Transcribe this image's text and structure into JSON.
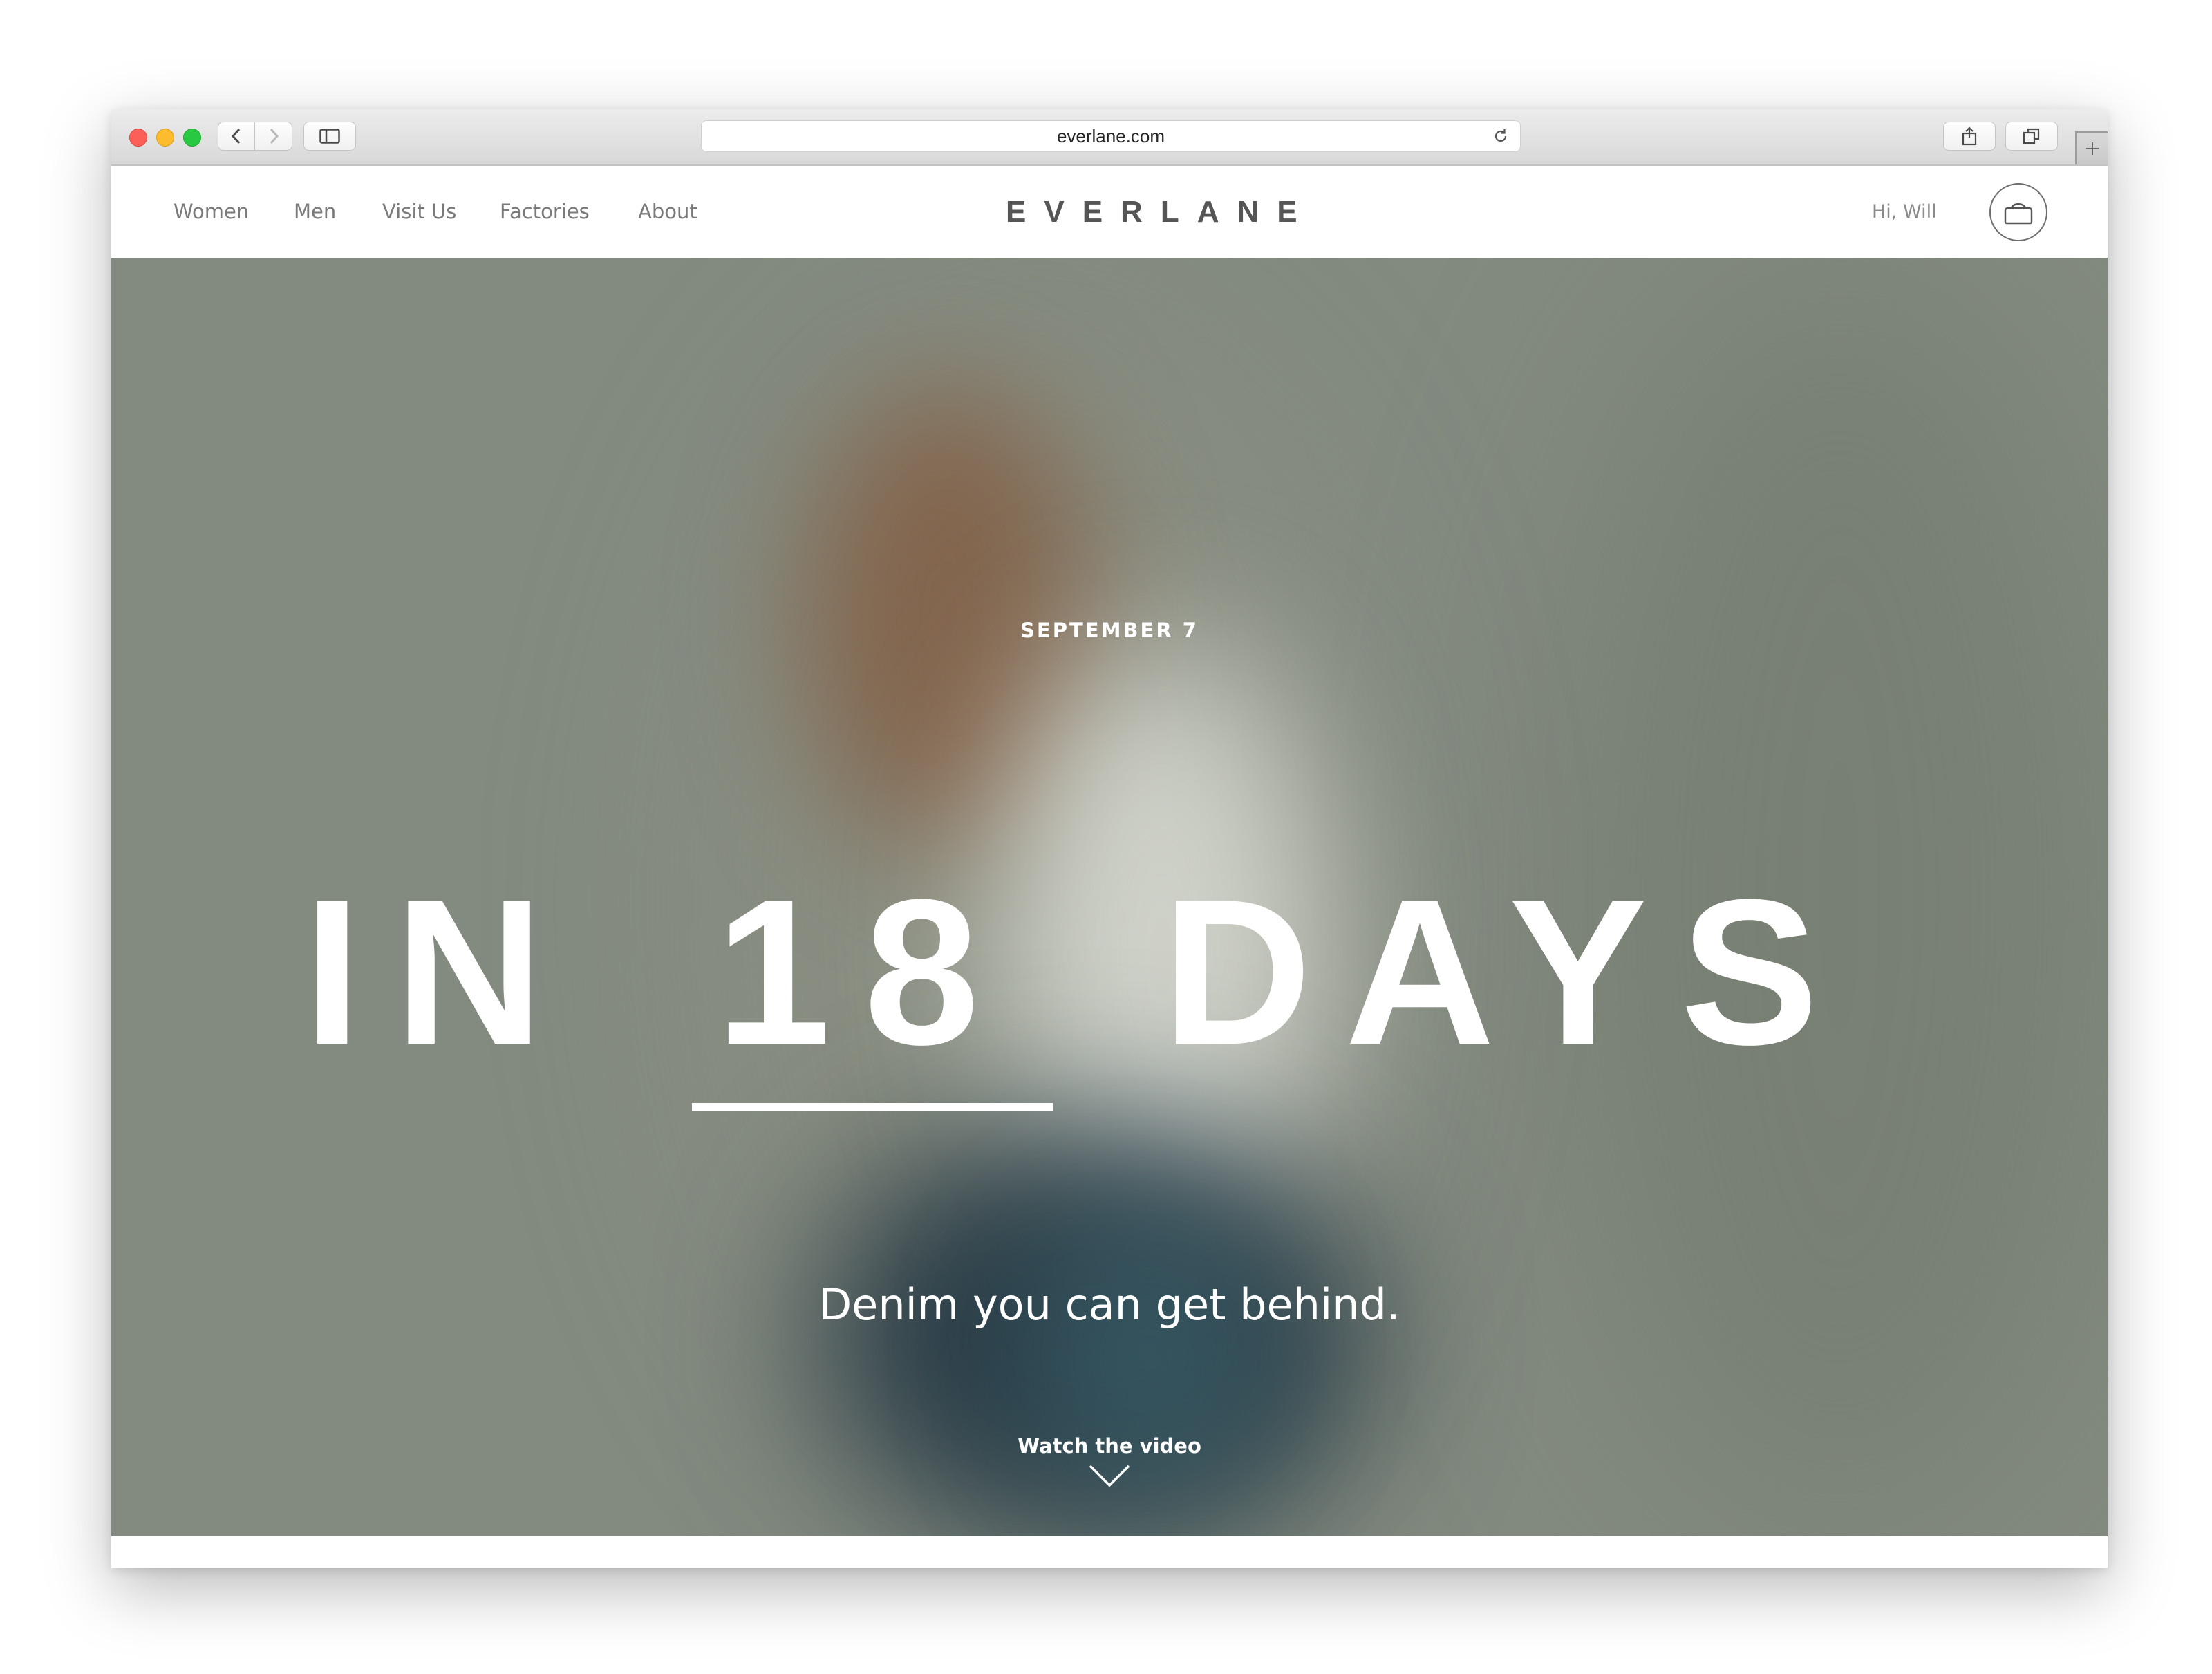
{
  "browser": {
    "url": "everlane.com",
    "icons": {
      "back": "chevron-left-icon",
      "forward": "chevron-right-icon",
      "sidebar": "sidebar-icon",
      "reload": "reload-icon",
      "share": "share-icon",
      "tabs": "tabs-icon",
      "new_tab": "plus-icon"
    }
  },
  "header": {
    "nav": [
      {
        "label": "Women"
      },
      {
        "label": "Men"
      },
      {
        "label": "Visit Us"
      },
      {
        "label": "Factories"
      },
      {
        "label": "About"
      }
    ],
    "logo": "EVERLANE",
    "greeting": "Hi, Will",
    "cart_icon": "bag-icon"
  },
  "hero": {
    "date": "SEPTEMBER 7",
    "headline_prefix": "IN",
    "headline_number": "18",
    "headline_suffix": "DAYS",
    "tagline": "Denim you can get behind.",
    "cta": "Watch the video",
    "cta_icon": "chevron-down-icon"
  },
  "colors": {
    "hero_background": "#838a7f",
    "text_on_hero": "#ffffff",
    "nav_text": "#7a7a7a",
    "logo": "#555555"
  }
}
